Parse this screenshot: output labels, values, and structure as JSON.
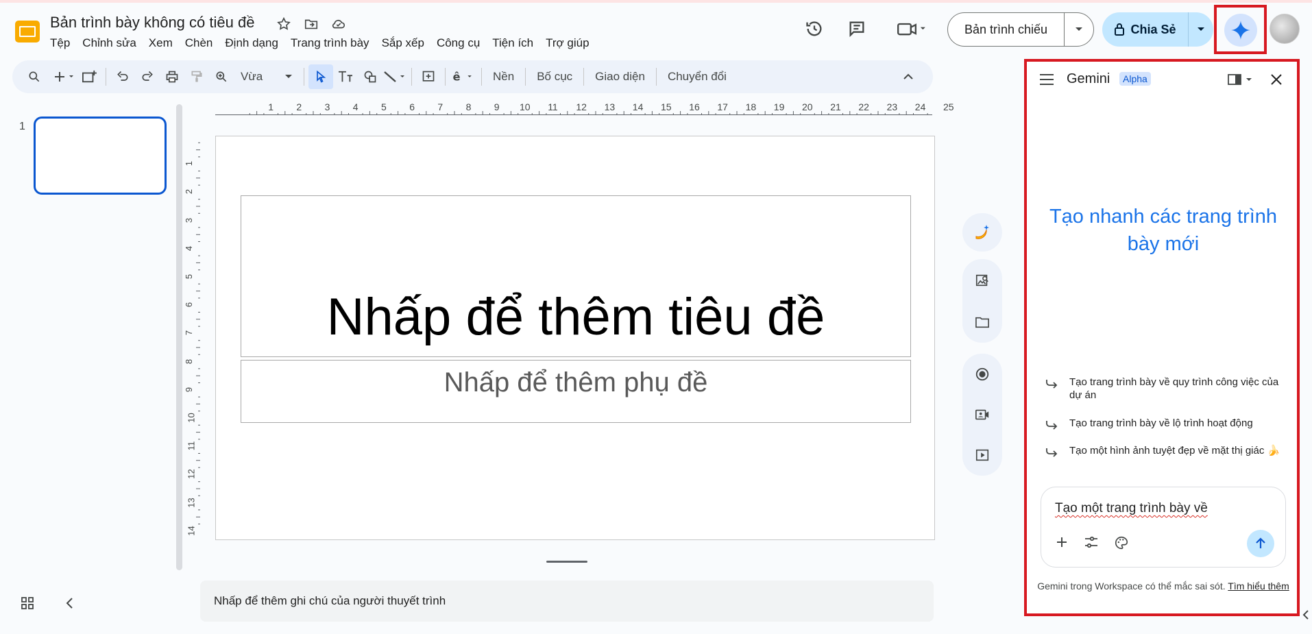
{
  "header": {
    "doc_title": "Bản trình bày không có tiêu đề",
    "menu": [
      "Tệp",
      "Chỉnh sửa",
      "Xem",
      "Chèn",
      "Định dạng",
      "Trang trình bày",
      "Sắp xếp",
      "Công cụ",
      "Tiện ích",
      "Trợ giúp"
    ],
    "present_label": "Bản trình chiếu",
    "share_label": "Chia Sẻ"
  },
  "toolbar": {
    "zoom": "Vừa",
    "background": "Nền",
    "layout": "Bố cục",
    "theme": "Giao diện",
    "transition": "Chuyển đổi"
  },
  "filmstrip": {
    "slide_number": "1"
  },
  "ruler": {
    "h": [
      "1",
      "2",
      "3",
      "4",
      "5",
      "6",
      "7",
      "8",
      "9",
      "10",
      "11",
      "12",
      "13",
      "14",
      "15",
      "16",
      "17",
      "18",
      "19",
      "20",
      "21",
      "22",
      "23",
      "24",
      "25"
    ],
    "v": [
      "1",
      "2",
      "3",
      "4",
      "5",
      "6",
      "7",
      "8",
      "9",
      "10",
      "11",
      "12",
      "13",
      "14"
    ]
  },
  "slide": {
    "title_placeholder": "Nhấp để thêm tiêu đề",
    "subtitle_placeholder": "Nhấp để thêm phụ đề"
  },
  "notes_placeholder": "Nhấp để thêm ghi chú của người thuyết trình",
  "gemini": {
    "title": "Gemini",
    "badge": "Alpha",
    "hero": "Tạo nhanh các trang trình bày mới",
    "suggestions": [
      "Tạo trang trình bày về quy trình công việc của dự án",
      "Tạo trang trình bày về lộ trình hoạt động",
      "Tạo một hình ảnh tuyệt đẹp về mặt thị giác 🍌"
    ],
    "input_value": "Tạo một trang trình bày về",
    "footer_text": "Gemini trong Workspace có thể mắc sai sót.",
    "footer_link": "Tìm hiểu thêm"
  },
  "colors": {
    "accent": "#0b57d0",
    "highlight": "#d71921",
    "share_bg": "#c2e7ff"
  }
}
